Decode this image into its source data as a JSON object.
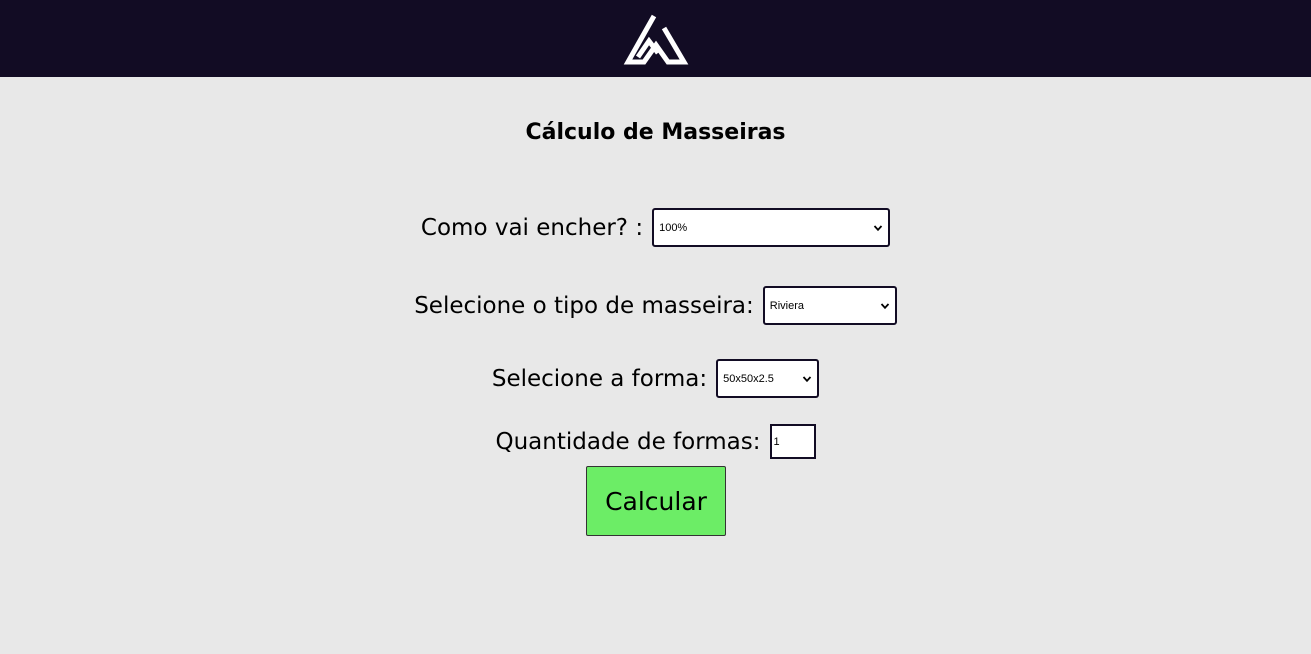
{
  "header": {
    "logo_icon": "brand-logo-icon"
  },
  "page": {
    "title": "Cálculo de Masseiras"
  },
  "form": {
    "fill": {
      "label": "Como vai encher? :",
      "selected": "100%"
    },
    "type": {
      "label": "Selecione o tipo de masseira:",
      "selected": "Riviera"
    },
    "shape": {
      "label": "Selecione a forma:",
      "selected": "50x50x2.5"
    },
    "quantity": {
      "label": "Quantidade de formas:",
      "value": "1"
    }
  },
  "actions": {
    "calculate_label": "Calcular"
  },
  "colors": {
    "header_bg": "#120c24",
    "page_bg": "#e8e8e8",
    "button_bg": "#6ced66",
    "border": "#120c24"
  }
}
